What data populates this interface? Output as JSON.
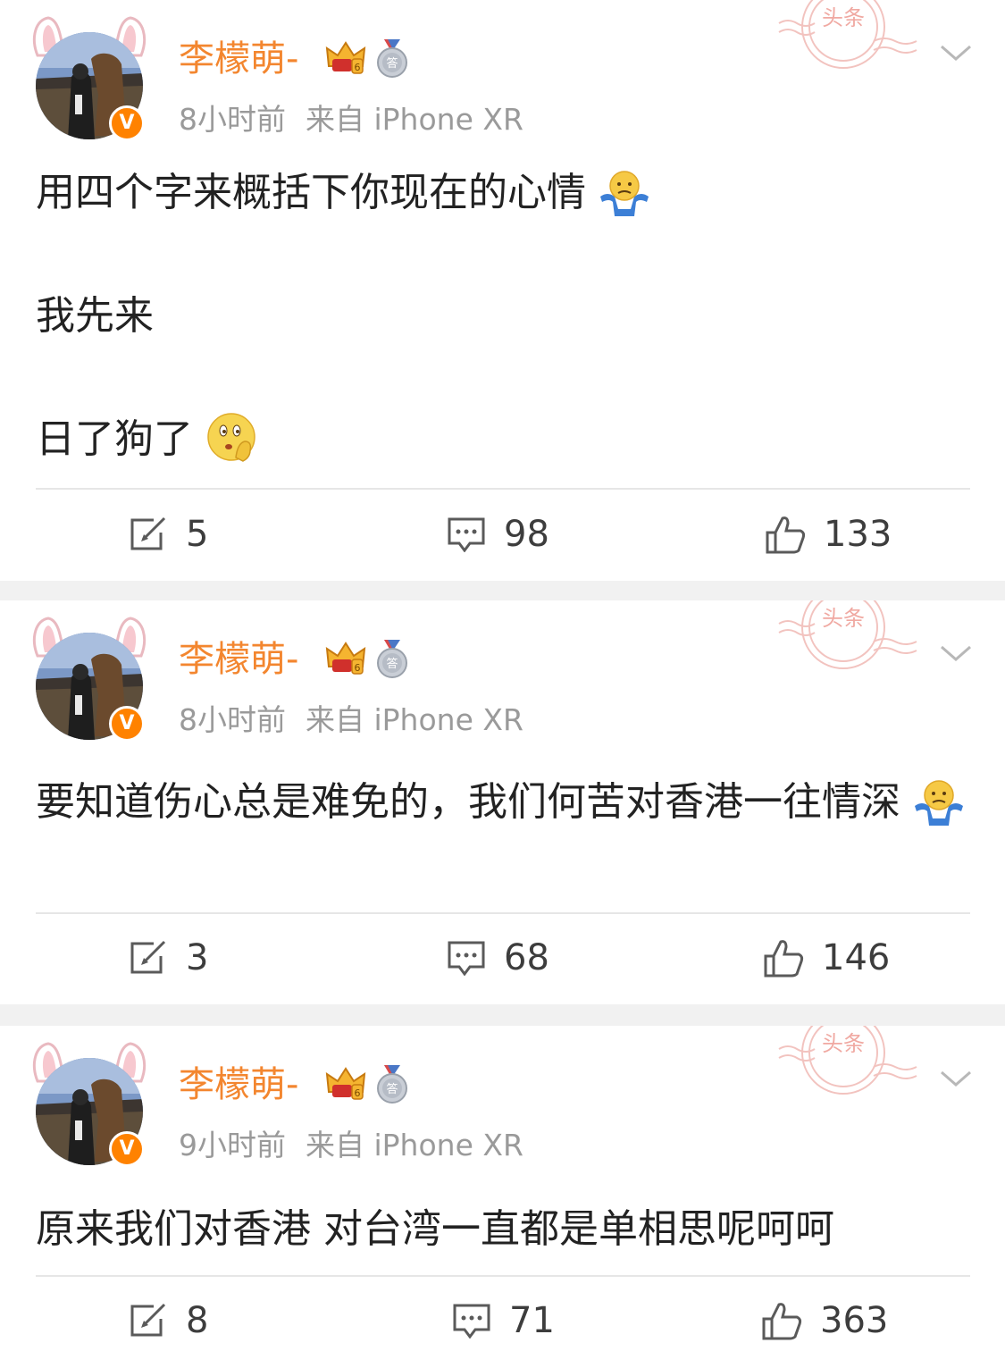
{
  "posts": [
    {
      "username": "李檬萌-",
      "time": "8小时前",
      "source": "来自 iPhone XR",
      "stamp_text": "头条",
      "badge": "V",
      "content": [
        "用四个字来概括下你现在的心情",
        "我先来",
        "日了狗了"
      ],
      "emojis": [
        "shrug-emoji",
        "thinking-emoji"
      ],
      "reposts": "5",
      "comments": "98",
      "likes": "133"
    },
    {
      "username": "李檬萌-",
      "time": "8小时前",
      "source": "来自 iPhone XR",
      "stamp_text": "头条",
      "badge": "V",
      "content": [
        "要知道伤心总是难免的，我们何苦对香港一往情深"
      ],
      "emojis": [
        "shrug-emoji"
      ],
      "reposts": "3",
      "comments": "68",
      "likes": "146"
    },
    {
      "username": "李檬萌-",
      "time": "9小时前",
      "source": "来自 iPhone XR",
      "stamp_text": "头条",
      "badge": "V",
      "content": [
        "原来我们对香港 对台湾一直都是单相思呢呵呵"
      ],
      "emojis": [],
      "reposts": "8",
      "comments": "71",
      "likes": "363"
    }
  ],
  "colors": {
    "username": "#f3862f",
    "meta": "#9a9a9a",
    "text": "#222222",
    "verified": "#ff8200",
    "separator": "#f1f1f1"
  }
}
